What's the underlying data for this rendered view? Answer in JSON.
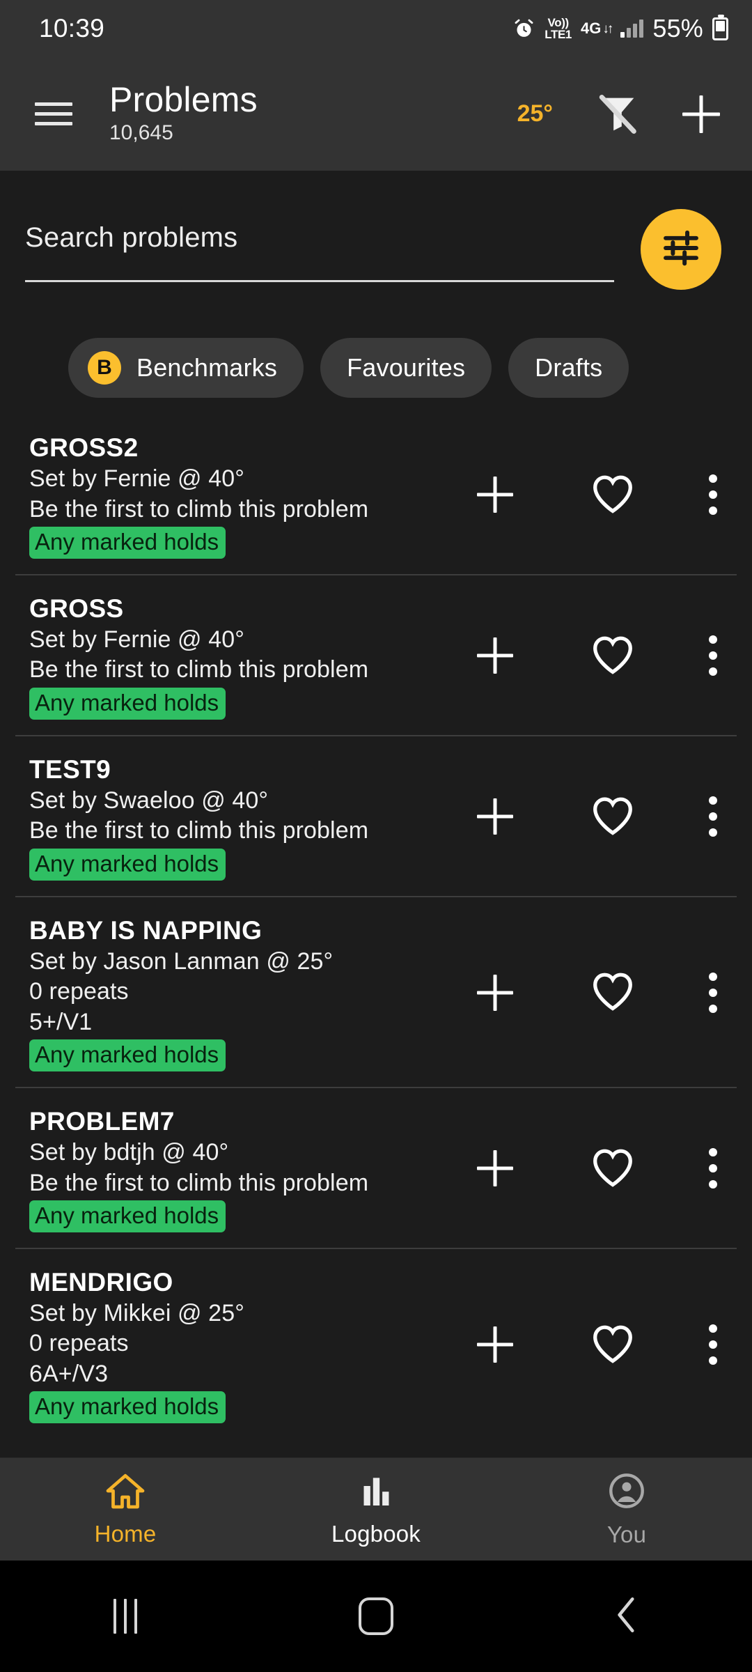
{
  "status_bar": {
    "time": "10:39",
    "alarm_icon": "alarm-clock-icon",
    "volte_top": "Vo))",
    "volte_bottom": "LTE1",
    "network_type": "4G",
    "data_arrows": "↓↑",
    "signal_icon": "signal-bars-icon",
    "battery_percent": "55%",
    "battery_icon": "battery-icon"
  },
  "app_bar": {
    "menu_icon": "hamburger-menu-icon",
    "title": "Problems",
    "count": "10,645",
    "angle": "25°",
    "filter_icon": "filter-off-icon",
    "add_icon": "plus-icon"
  },
  "search": {
    "placeholder": "Search problems",
    "value": "",
    "fab_icon": "tune-sliders-icon"
  },
  "chips": [
    {
      "label": "Benchmarks",
      "badge": "B",
      "has_badge": true,
      "selected": false
    },
    {
      "label": "Favourites",
      "badge": "",
      "has_badge": false,
      "selected": false
    },
    {
      "label": "Drafts",
      "badge": "",
      "has_badge": false,
      "selected": false
    }
  ],
  "problems": [
    {
      "name": "GROSS2",
      "setter": "Set by Fernie @ 40°",
      "line2": "Be the first to climb this problem",
      "line3": "",
      "badge": "Any marked holds"
    },
    {
      "name": "GROSS",
      "setter": "Set by Fernie @ 40°",
      "line2": "Be the first to climb this problem",
      "line3": "",
      "badge": "Any marked holds"
    },
    {
      "name": "TEST9",
      "setter": "Set by Swaeloo @ 40°",
      "line2": "Be the first to climb this problem",
      "line3": "",
      "badge": "Any marked holds"
    },
    {
      "name": "BABY IS NAPPING",
      "setter": "Set by Jason Lanman @ 25°",
      "line2": "0 repeats",
      "line3": "5+/V1",
      "badge": "Any marked holds"
    },
    {
      "name": "PROBLEM7",
      "setter": "Set by bdtjh @ 40°",
      "line2": "Be the first to climb this problem",
      "line3": "",
      "badge": "Any marked holds"
    },
    {
      "name": "MENDRIGO",
      "setter": "Set by Mikkei @ 25°",
      "line2": "0 repeats",
      "line3": "6A+/V3",
      "badge": "Any marked holds"
    }
  ],
  "row_actions": {
    "add_icon": "plus-icon",
    "favourite_icon": "heart-outline-icon",
    "overflow_icon": "more-vertical-icon"
  },
  "bottom_nav": [
    {
      "label": "Home",
      "icon": "home-icon",
      "active": true
    },
    {
      "label": "Logbook",
      "icon": "bar-chart-icon",
      "active": false
    },
    {
      "label": "You",
      "icon": "account-circle-icon",
      "active": false
    }
  ],
  "system_nav": {
    "recents_icon": "recents-icon",
    "home_icon": "home-square-icon",
    "back_icon": "back-chevron-icon"
  },
  "colors": {
    "accent": "#fbbf2e",
    "badge_green": "#2fbf63",
    "app_bar": "#333333",
    "background": "#1c1c1c"
  }
}
